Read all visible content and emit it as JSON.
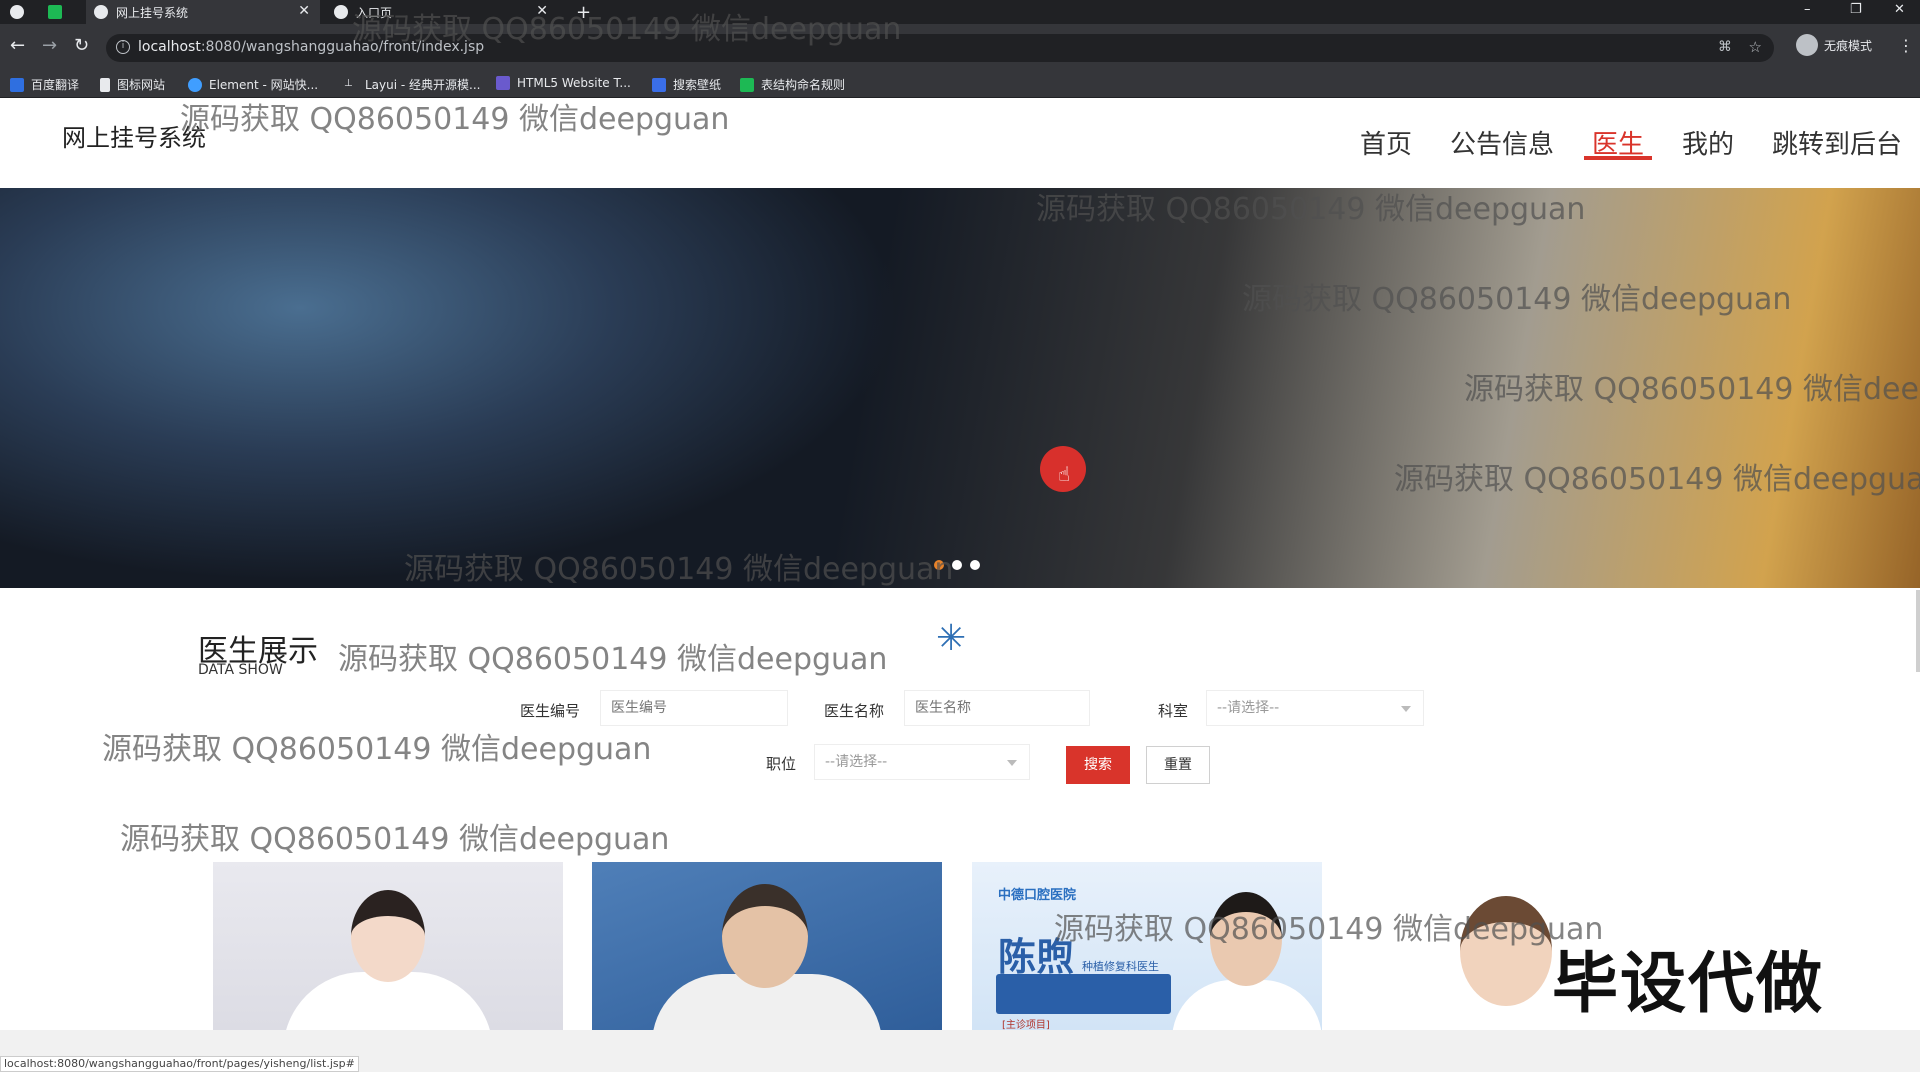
{
  "browser": {
    "tabs": [
      {
        "label": ""
      },
      {
        "label": "网上挂号系统"
      },
      {
        "label": "入口页"
      }
    ],
    "new_tab": "+",
    "url_host": "localhost",
    "url_rest": ":8080/wangshangguahao/front/index.jsp",
    "profile_label": "无痕模式",
    "bookmarks": [
      {
        "label": "百度翻译",
        "color": "#2f6fe0"
      },
      {
        "label": "图标网站",
        "color": "#e8eaed"
      },
      {
        "label": "Element - 网站快...",
        "color": "#409eff"
      },
      {
        "label": "Layui - 经典开源模...",
        "color": "#e8eaed"
      },
      {
        "label": "HTML5 Website T...",
        "color": "#6a5acd"
      },
      {
        "label": "搜索壁纸",
        "color": "#3a6ee8"
      },
      {
        "label": "表结构命名规则",
        "color": "#1db954"
      }
    ]
  },
  "site": {
    "title": "网上挂号系统",
    "nav": [
      "首页",
      "公告信息",
      "医生",
      "我的",
      "跳转到后台"
    ],
    "accent": "#d9342b"
  },
  "banner": {
    "slide_count": 3,
    "active_slide": 1
  },
  "section": {
    "title": "医生展示",
    "subtitle": "DATA SHOW"
  },
  "filters": {
    "doctor_no_label": "医生编号",
    "doctor_no_placeholder": "医生编号",
    "doctor_name_label": "医生名称",
    "doctor_name_placeholder": "医生名称",
    "dept_label": "科室",
    "dept_value": "--请选择--",
    "position_label": "职位",
    "position_value": "--请选择--",
    "search_label": "搜索",
    "reset_label": "重置"
  },
  "cards": {
    "card3_org": "中德口腔医院",
    "card3_name": "陈煦",
    "card3_title": "种植修复科医生",
    "card3_tag": "[主诊项目]"
  },
  "promo": "毕设代做",
  "watermark": "源码获取 QQ86050149 微信deepguan",
  "status_url": "localhost:8080/wangshangguahao/front/pages/yisheng/list.jsp#"
}
